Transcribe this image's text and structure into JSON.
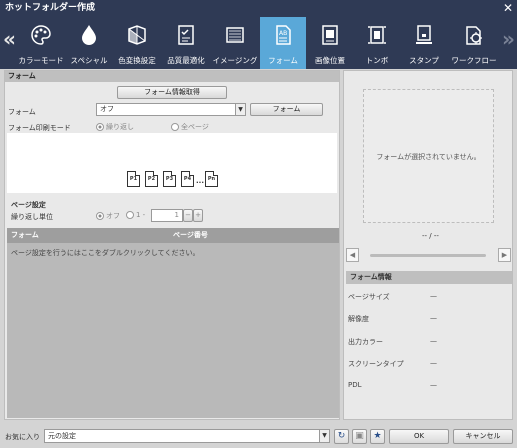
{
  "window": {
    "title": "ホットフォルダー作成",
    "close_icon": "close-icon"
  },
  "toolbar": {
    "items": [
      {
        "label": "カラーモード",
        "icon": "palette-icon"
      },
      {
        "label": "スペシャル",
        "icon": "droplet-icon"
      },
      {
        "label": "色変換設定",
        "icon": "color-convert-icon"
      },
      {
        "label": "品質最適化",
        "icon": "quality-check-icon"
      },
      {
        "label": "イメージング",
        "icon": "imaging-icon"
      },
      {
        "label": "フォーム",
        "icon": "form-icon",
        "active": true
      },
      {
        "label": "画像位置",
        "icon": "image-position-icon"
      },
      {
        "label": "トンボ",
        "icon": "trim-marks-icon"
      },
      {
        "label": "スタンプ",
        "icon": "stamp-icon"
      },
      {
        "label": "ワークフロー",
        "icon": "workflow-icon"
      }
    ],
    "active_color": "#5aa8d8",
    "bg_color": "#2f3a55"
  },
  "form_section": {
    "header": "フォーム",
    "get_info_button": "フォーム情報取得",
    "form_label": "フォーム",
    "form_select_value": "オフ",
    "form_button": "フォーム",
    "print_mode_label": "フォーム印刷モード",
    "mode_repeat": "繰り返し",
    "mode_all_pages": "全ページ",
    "pages": [
      "P1",
      "P2",
      "P3",
      "P4",
      "...",
      "Pn"
    ]
  },
  "page_settings": {
    "header": "ページ設定",
    "repeat_unit_label": "繰り返し単位",
    "off_option": "オフ",
    "one_option": "1 -",
    "value": "1"
  },
  "table": {
    "columns": [
      "フォーム",
      "ページ番号"
    ],
    "hint": "ページ設定を行うにはここをダブルクリックしてください。"
  },
  "preview": {
    "empty_message": "フォームが選択されていません。",
    "page_indicator": "-- / --"
  },
  "form_info": {
    "header": "フォーム情報",
    "rows": [
      {
        "label": "ページサイズ",
        "value": "—"
      },
      {
        "label": "解像度",
        "value": "—"
      },
      {
        "label": "出力カラー",
        "value": "—"
      },
      {
        "label": "スクリーンタイプ",
        "value": "—"
      },
      {
        "label": "PDL",
        "value": "—"
      }
    ]
  },
  "bottom": {
    "favorites_label": "お気に入り",
    "favorites_value": "元の設定",
    "ok": "OK",
    "cancel": "キャンセル"
  }
}
